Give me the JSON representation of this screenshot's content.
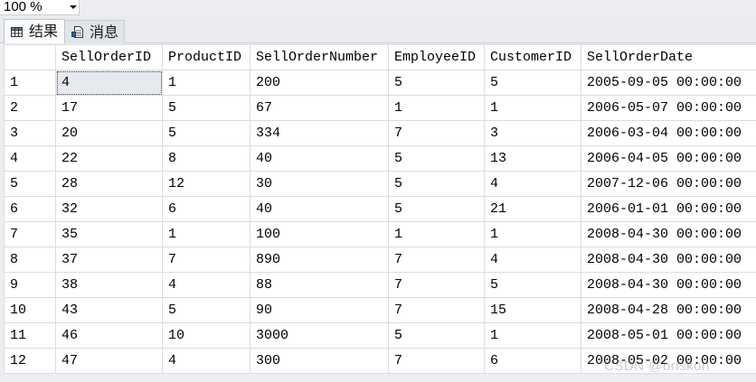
{
  "zoom": {
    "value": "100 %"
  },
  "tabs": [
    {
      "label": "结果",
      "icon": "grid-icon"
    },
    {
      "label": "消息",
      "icon": "message-icon"
    }
  ],
  "grid": {
    "columns": [
      "SellOrderID",
      "ProductID",
      "SellOrderNumber",
      "EmployeeID",
      "CustomerID",
      "SellOrderDate"
    ],
    "rows": [
      {
        "num": "1",
        "cells": [
          "4",
          "1",
          "200",
          "5",
          "5",
          "2005-09-05 00:00:00"
        ]
      },
      {
        "num": "2",
        "cells": [
          "17",
          "5",
          "67",
          "1",
          "1",
          "2006-05-07 00:00:00"
        ]
      },
      {
        "num": "3",
        "cells": [
          "20",
          "5",
          "334",
          "7",
          "3",
          "2006-03-04 00:00:00"
        ]
      },
      {
        "num": "4",
        "cells": [
          "22",
          "8",
          "40",
          "5",
          "13",
          "2006-04-05 00:00:00"
        ]
      },
      {
        "num": "5",
        "cells": [
          "28",
          "12",
          "30",
          "5",
          "4",
          "2007-12-06 00:00:00"
        ]
      },
      {
        "num": "6",
        "cells": [
          "32",
          "6",
          "40",
          "5",
          "21",
          "2006-01-01 00:00:00"
        ]
      },
      {
        "num": "7",
        "cells": [
          "35",
          "1",
          "100",
          "1",
          "1",
          "2008-04-30 00:00:00"
        ]
      },
      {
        "num": "8",
        "cells": [
          "37",
          "7",
          "890",
          "7",
          "4",
          "2008-04-30 00:00:00"
        ]
      },
      {
        "num": "9",
        "cells": [
          "38",
          "4",
          "88",
          "7",
          "5",
          "2008-04-30 00:00:00"
        ]
      },
      {
        "num": "10",
        "cells": [
          "43",
          "5",
          "90",
          "7",
          "15",
          "2008-04-28 00:00:00"
        ]
      },
      {
        "num": "11",
        "cells": [
          "46",
          "10",
          "3000",
          "5",
          "1",
          "2008-05-01 00:00:00"
        ]
      },
      {
        "num": "12",
        "cells": [
          "47",
          "4",
          "300",
          "7",
          "6",
          "2008-05-02 00:00:00"
        ]
      }
    ],
    "selected_cell": {
      "row": 0,
      "col": 0
    }
  },
  "watermark": "CSDN @briskon"
}
